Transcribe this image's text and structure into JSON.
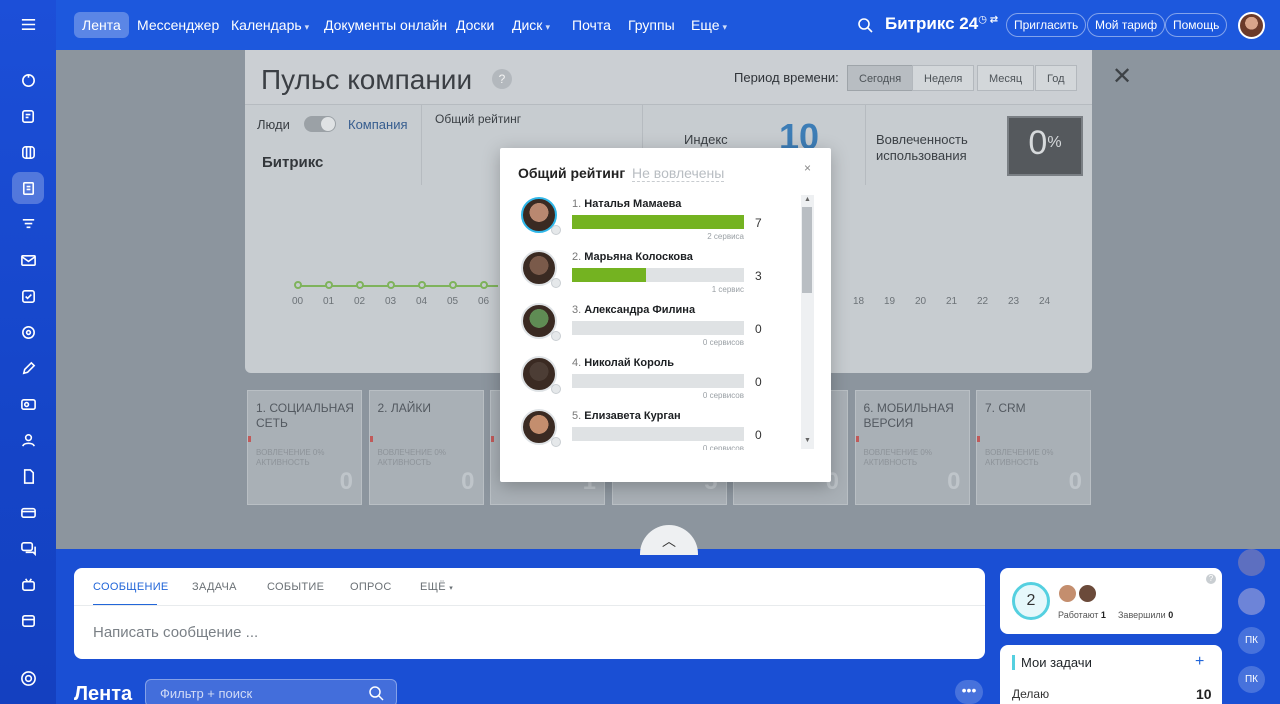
{
  "topbar": {
    "nav": [
      {
        "label": "Лента",
        "active": true
      },
      {
        "label": "Мессенджер"
      },
      {
        "label": "Календарь",
        "caret": true
      },
      {
        "label": "Документы онлайн"
      },
      {
        "label": "Доски"
      },
      {
        "label": "Диск",
        "caret": true
      },
      {
        "label": "Почта"
      },
      {
        "label": "Группы"
      },
      {
        "label": "Еще",
        "caret": true
      }
    ],
    "brand": "Битрикс 24",
    "invite": "Пригласить",
    "tariff": "Мой тариф",
    "help": "Помощь"
  },
  "pulse": {
    "title": "Пульс компании",
    "help_mark": "?",
    "period_label": "Период времени:",
    "periods": [
      "Сегодня",
      "Неделя",
      "Месяц",
      "Год"
    ],
    "people": "Люди",
    "company": "Компания",
    "org": "Битрикс",
    "rating": "Общий рейтинг",
    "index_label": "Индекс",
    "index_value": "10",
    "involvement_label": "Вовлеченность использования",
    "involvement_value": "0",
    "involvement_unit": "%",
    "hours_left": [
      "00",
      "01",
      "02",
      "03",
      "04",
      "05",
      "06"
    ],
    "hours_right": [
      "18",
      "19",
      "20",
      "21",
      "22",
      "23",
      "24"
    ],
    "cards": [
      {
        "title": "1. СОЦИАЛЬНАЯ СЕТЬ",
        "sub": "ВОВЛЕЧЕНИЕ 0% АКТИВНОСТЬ",
        "value": "0"
      },
      {
        "title": "2. ЛАЙКИ",
        "sub": "ВОВЛЕЧЕНИЕ 0% АКТИВНОСТЬ",
        "value": "0"
      },
      {
        "title": "",
        "sub": "",
        "value": "1"
      },
      {
        "title": "",
        "sub": "",
        "value": "5"
      },
      {
        "title": "",
        "sub": "",
        "value": "0"
      },
      {
        "title": "6. МОБИЛЬНАЯ ВЕРСИЯ",
        "sub": "ВОВЛЕЧЕНИЕ 0% АКТИВНОСТЬ",
        "value": "0"
      },
      {
        "title": "7. CRM",
        "sub": "ВОВЛЕЧЕНИЕ 0% АКТИВНОСТЬ",
        "value": "0"
      }
    ]
  },
  "modal": {
    "tab_active": "Общий рейтинг",
    "tab_inactive": "Не вовлечены",
    "close": "×",
    "items": [
      {
        "rank": "1.",
        "name": "Наталья Мамаева",
        "value": "7",
        "services": "2 сервиса",
        "fill": 1.0,
        "color": "#b98870"
      },
      {
        "rank": "2.",
        "name": "Марьяна Колоскова",
        "value": "3",
        "services": "1 сервис",
        "fill": 0.43,
        "color": "#7a5a4a"
      },
      {
        "rank": "3.",
        "name": "Александра Филина",
        "value": "0",
        "services": "0 сервисов",
        "fill": 0,
        "color": "#5f8c54"
      },
      {
        "rank": "4.",
        "name": "Николай Король",
        "value": "0",
        "services": "0 сервисов",
        "fill": 0,
        "color": "#4c3d35"
      },
      {
        "rank": "5.",
        "name": "Елизавета Курган",
        "value": "0",
        "services": "0 сервисов",
        "fill": 0,
        "color": "#c48e6e"
      }
    ]
  },
  "composer": {
    "tabs": [
      "СООБЩЕНИЕ",
      "ЗАДАЧА",
      "СОБЫТИЕ",
      "ОПРОС",
      "ЕЩЁ"
    ],
    "placeholder": "Написать сообщение ..."
  },
  "feed": {
    "title": "Лента",
    "filter_placeholder": "Фильтр + поиск"
  },
  "work_widget": {
    "count": "2",
    "working_label": "Работают",
    "working_value": "1",
    "finished_label": "Завершили",
    "finished_value": "0"
  },
  "tasks_widget": {
    "title": "Мои задачи",
    "row_label": "Делаю",
    "row_value": "10"
  },
  "right_bubbles": [
    "ПК",
    "ПК"
  ],
  "colors": {
    "accent": "#1d58dd",
    "progress": "#74b321",
    "highlight": "#55d0e0"
  }
}
